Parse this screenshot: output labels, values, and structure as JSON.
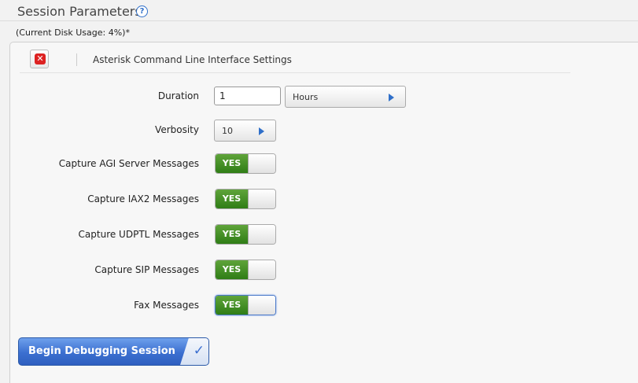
{
  "header": {
    "title": "Session Parameters",
    "help_glyph": "?"
  },
  "disk_usage": "(Current Disk Usage: 4%)*",
  "panel": {
    "title": "Asterisk Command Line Interface Settings",
    "close_glyph": "✕"
  },
  "form": {
    "duration": {
      "label": "Duration",
      "value": "1",
      "unit": "Hours"
    },
    "verbosity": {
      "label": "Verbosity",
      "value": "10"
    },
    "toggles": [
      {
        "label": "Capture AGI Server Messages",
        "state": "YES"
      },
      {
        "label": "Capture IAX2 Messages",
        "state": "YES"
      },
      {
        "label": "Capture UDPTL Messages",
        "state": "YES"
      },
      {
        "label": "Capture SIP Messages",
        "state": "YES"
      },
      {
        "label": "Fax Messages",
        "state": "YES"
      }
    ]
  },
  "actions": {
    "begin_label": "Begin Debugging Session",
    "begin_glyph": "✓"
  },
  "colors": {
    "accent": "#2f6fc9",
    "toggle_on": "#3f8d22",
    "close": "#d22222"
  }
}
